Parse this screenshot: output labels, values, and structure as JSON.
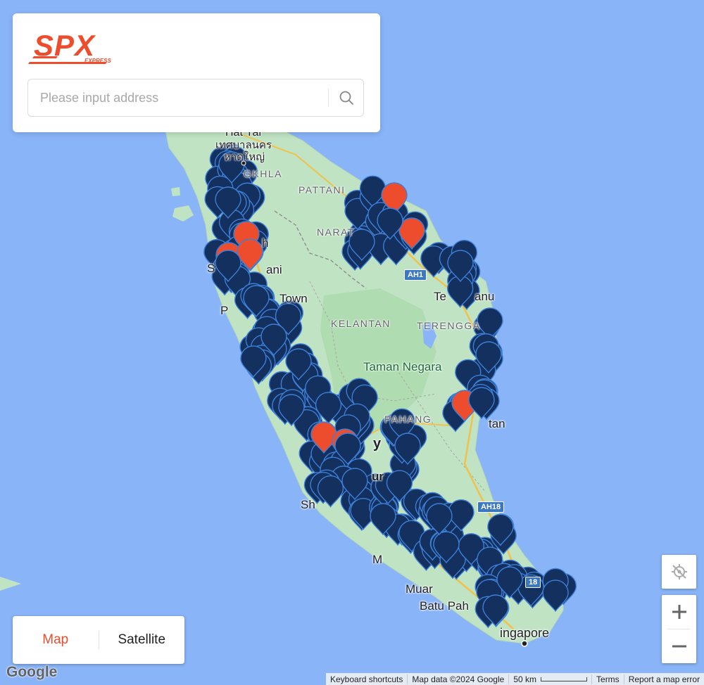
{
  "colors": {
    "water": "#8ab4f8",
    "land": "#bfe3c3",
    "brand": "#ee4d2d",
    "pin": "#13305f",
    "pin_highlight": "#ee4d2d"
  },
  "brand": {
    "name": "SPX",
    "tagline": "EXPRESS"
  },
  "search": {
    "placeholder": "Please input address",
    "value": "",
    "icon": "search-icon"
  },
  "map_type": {
    "map_label": "Map",
    "satellite_label": "Satellite",
    "selected": "Map"
  },
  "controls": {
    "locate_icon": "locate-icon",
    "zoom_in_icon": "plus-icon",
    "zoom_out_icon": "minus-icon"
  },
  "labels": {
    "hat_yai_1": "Hat Yai",
    "hat_yai_2": "เทศบาลนคร",
    "hat_yai_3": "หาดใหญ่",
    "songkhla": "GKHLA",
    "pattani": "PATTANI",
    "narat": "NARAT",
    "h_frag": "h",
    "s_frag": "S",
    "ani_frag": "ani",
    "p_frag": "P",
    "town": "Town",
    "te_frag": "Te",
    "anu_frag": "anu",
    "kelantan": "KELANTAN",
    "terengganu": "TERENGGA",
    "taman_negara": "Taman Negara",
    "pahang": "PAHANG",
    "tan_frag": "tan",
    "y_frag": "y",
    "ur_frag": "ur",
    "sh_frag": "Sh",
    "m_frag": "M",
    "muar": "Muar",
    "batu_pahat": "Batu Pah",
    "singapore": "ingapore"
  },
  "roads": {
    "ah1": "AH1",
    "ah18_a": "AH18",
    "ah18_b": "18"
  },
  "attribution": {
    "google": "Google",
    "shortcuts": "Keyboard shortcuts",
    "map_data": "Map data ©2024 Google",
    "scale": "50 km",
    "terms": "Terms",
    "report": "Report a map error"
  }
}
